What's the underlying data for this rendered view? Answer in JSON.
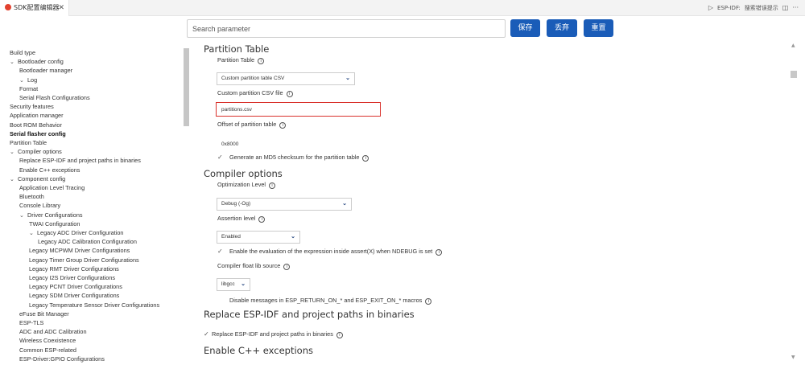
{
  "tab": {
    "title": "SDK配置编辑器",
    "close": "✕"
  },
  "titlebar": {
    "run_icon": "▷",
    "esp_label": "ESP-IDF:",
    "hint_label": "搜索错误提示",
    "split_icon": "◫",
    "more_icon": "···"
  },
  "header": {
    "search_placeholder": "Search parameter",
    "save_label": "保存",
    "discard_label": "丢弃",
    "reset_label": "重置"
  },
  "sidebar": {
    "items": [
      {
        "label": "Build type",
        "chev": "",
        "indent": 0
      },
      {
        "label": "Bootloader config",
        "chev": "⌄",
        "indent": 1
      },
      {
        "label": "Bootloader manager",
        "chev": "",
        "indent": 2
      },
      {
        "label": "Log",
        "chev": "⌄",
        "indent": 2
      },
      {
        "label": "Format",
        "chev": "",
        "indent": 3
      },
      {
        "label": "Serial Flash Configurations",
        "chev": "",
        "indent": 2
      },
      {
        "label": "Security features",
        "chev": "",
        "indent": 0
      },
      {
        "label": "Application manager",
        "chev": "",
        "indent": 0
      },
      {
        "label": "Boot ROM Behavior",
        "chev": "",
        "indent": 0
      },
      {
        "label": "Serial flasher config",
        "chev": "",
        "indent": 0,
        "bold": true
      },
      {
        "label": "Partition Table",
        "chev": "",
        "indent": 0
      },
      {
        "label": "Compiler options",
        "chev": "⌄",
        "indent": 1
      },
      {
        "label": "Replace ESP-IDF and project paths in binaries",
        "chev": "",
        "indent": 2
      },
      {
        "label": "Enable C++ exceptions",
        "chev": "",
        "indent": 2
      },
      {
        "label": "Component config",
        "chev": "⌄",
        "indent": 1
      },
      {
        "label": "Application Level Tracing",
        "chev": "",
        "indent": 2
      },
      {
        "label": "Bluetooth",
        "chev": "",
        "indent": 2
      },
      {
        "label": "Console Library",
        "chev": "",
        "indent": 2
      },
      {
        "label": "Driver Configurations",
        "chev": "⌄",
        "indent": 3
      },
      {
        "label": "TWAI Configuration",
        "chev": "",
        "indent": 4
      },
      {
        "label": "Legacy ADC Driver Configuration",
        "chev": "⌄",
        "indent": 4
      },
      {
        "label": "Legacy ADC Calibration Configuration",
        "chev": "",
        "indent": 5
      },
      {
        "label": "Legacy MCPWM Driver Configurations",
        "chev": "",
        "indent": 4
      },
      {
        "label": "Legacy Timer Group Driver Configurations",
        "chev": "",
        "indent": 4
      },
      {
        "label": "Legacy RMT Driver Configurations",
        "chev": "",
        "indent": 4
      },
      {
        "label": "Legacy I2S Driver Configurations",
        "chev": "",
        "indent": 4
      },
      {
        "label": "Legacy PCNT Driver Configurations",
        "chev": "",
        "indent": 4
      },
      {
        "label": "Legacy SDM Driver Configurations",
        "chev": "",
        "indent": 4
      },
      {
        "label": "Legacy Temperature Sensor Driver Configurations",
        "chev": "",
        "indent": 4
      },
      {
        "label": "eFuse Bit Manager",
        "chev": "",
        "indent": 2
      },
      {
        "label": "ESP-TLS",
        "chev": "",
        "indent": 2
      },
      {
        "label": "ADC and ADC Calibration",
        "chev": "",
        "indent": 2
      },
      {
        "label": "Wireless Coexistence",
        "chev": "",
        "indent": 2
      },
      {
        "label": "Common ESP-related",
        "chev": "",
        "indent": 2
      },
      {
        "label": "ESP-Driver:GPIO Configurations",
        "chev": "",
        "indent": 2
      }
    ]
  },
  "main": {
    "partition": {
      "title": "Partition Table",
      "table_label": "Partition Table",
      "table_value": "Custom partition table CSV",
      "csv_label": "Custom partition CSV file",
      "csv_value": "partitions.csv",
      "offset_label": "Offset of partition table",
      "offset_value": "0x8000",
      "md5_label": "Generate an MD5 checksum for the partition table"
    },
    "compiler": {
      "title": "Compiler options",
      "opt_label": "Optimization Level",
      "opt_value": "Debug (-Og)",
      "assert_label": "Assertion level",
      "assert_value": "Enabled",
      "ndebug_label": "Enable the evaluation of the expression inside assert(X) when NDEBUG is set",
      "float_label": "Compiler float lib source",
      "float_value": "libgcc",
      "disable_msg_label": "Disable messages in ESP_RETURN_ON_* and ESP_EXIT_ON_* macros"
    },
    "replace": {
      "title": "Replace ESP-IDF and project paths in binaries",
      "check_label": "Replace ESP-IDF and project paths in binaries"
    },
    "cpp": {
      "title": "Enable C++ exceptions"
    }
  },
  "glyphs": {
    "info": "i",
    "caret": "⌄",
    "check": "✓"
  }
}
